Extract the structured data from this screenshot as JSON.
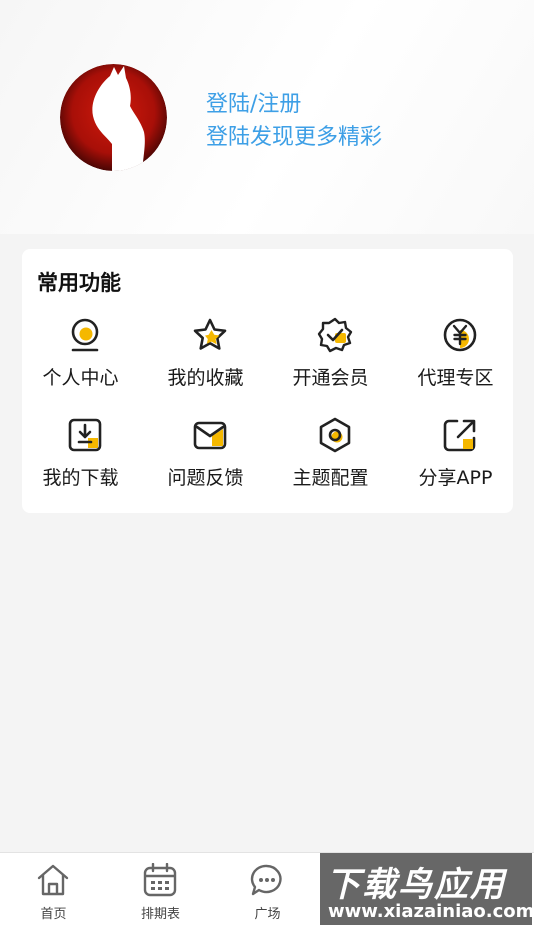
{
  "profile": {
    "login_label": "登陆/注册",
    "login_hint": "登陆发现更多精彩"
  },
  "common_functions": {
    "title": "常用功能",
    "items": [
      {
        "label": "个人中心",
        "icon": "user-center-icon"
      },
      {
        "label": "我的收藏",
        "icon": "star-icon"
      },
      {
        "label": "开通会员",
        "icon": "vip-badge-icon"
      },
      {
        "label": "代理专区",
        "icon": "yen-coin-icon"
      },
      {
        "label": "我的下载",
        "icon": "download-icon"
      },
      {
        "label": "问题反馈",
        "icon": "mail-icon"
      },
      {
        "label": "主题配置",
        "icon": "theme-hexagon-icon"
      },
      {
        "label": "分享APP",
        "icon": "share-icon"
      }
    ]
  },
  "tabbar": {
    "items": [
      {
        "label": "首页",
        "icon": "home-icon"
      },
      {
        "label": "排期表",
        "icon": "calendar-icon"
      },
      {
        "label": "广场",
        "icon": "chat-bubble-icon"
      }
    ]
  },
  "watermark": {
    "main": "下载鸟应用",
    "sub": "www.xiazainiao.com"
  },
  "colors": {
    "accent_link": "#3d9fe6",
    "icon_accent": "#f5b800",
    "icon_stroke": "#222222",
    "page_background": "#f4f4f4"
  }
}
